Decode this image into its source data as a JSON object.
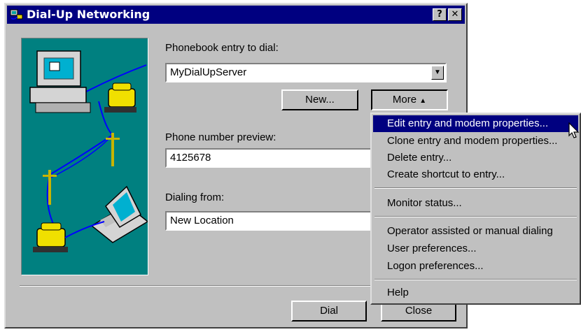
{
  "window": {
    "title": "Dial-Up Networking",
    "help_button": "?",
    "close_button": "✕"
  },
  "phonebook": {
    "label": "Phonebook entry to dial:",
    "value": "MyDialUpServer"
  },
  "buttons": {
    "new_label": "New...",
    "more_label": "More",
    "dial_label": "Dial",
    "close_label": "Close"
  },
  "preview": {
    "label": "Phone number preview:",
    "value": "4125678"
  },
  "dialing_from": {
    "label": "Dialing from:",
    "value": "New Location"
  },
  "menu": {
    "items": [
      {
        "label": "Edit entry and modem properties...",
        "highlighted": true
      },
      {
        "label": "Clone entry and modem properties..."
      },
      {
        "label": "Delete entry..."
      },
      {
        "label": "Create shortcut to entry..."
      },
      {
        "label": "Monitor status..."
      },
      {
        "label": "Operator assisted or manual dialing"
      },
      {
        "label": "User preferences..."
      },
      {
        "label": "Logon preferences..."
      },
      {
        "label": "Help"
      }
    ]
  },
  "colors": {
    "titlebar": "#000080",
    "illustration_bg": "#008080",
    "dialog_bg": "#c0c0c0",
    "menu_highlight": "#000080"
  },
  "icons": [
    "dialup-app-icon",
    "computer-phone-illustration-icon",
    "laptop-phone-illustration-icon",
    "chevron-down-icon",
    "triangle-up-icon",
    "mouse-cursor-icon"
  ]
}
